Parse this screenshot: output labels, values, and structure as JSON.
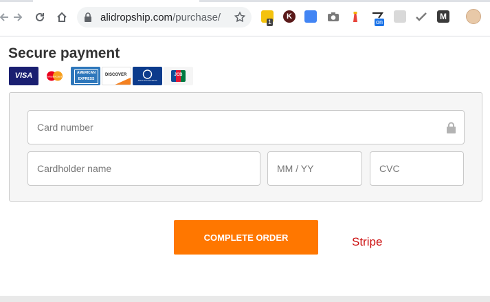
{
  "browser": {
    "url_domain": "alidropship.com",
    "url_path": "/purchase/",
    "extensions": [
      {
        "name": "notes-extension",
        "badge": "1",
        "color": "#f4c20d",
        "badge_color": "#444444"
      },
      {
        "name": "k-extension",
        "color": "#5a1a1a",
        "letter": "K"
      },
      {
        "name": "google-translate-extension",
        "color": "#4285f4"
      },
      {
        "name": "camera-extension",
        "color": "#7a7a7a"
      },
      {
        "name": "lighthouse-extension",
        "color": "#e8453c"
      },
      {
        "name": "toggle-extension",
        "badge": "on",
        "badge_color": "#1a73e8"
      },
      {
        "name": "translator-extension",
        "color": "#b5b5b5"
      },
      {
        "name": "check-extension",
        "color": "#7a7a7a"
      },
      {
        "name": "m-extension",
        "color": "#3a3a3a",
        "letter": "M"
      }
    ]
  },
  "page": {
    "title": "Secure payment",
    "card_brands": [
      {
        "name": "visa",
        "label": "VISA",
        "bg": "#1a1f71",
        "fg": "#ffffff"
      },
      {
        "name": "mastercard",
        "label": "MasterCard",
        "bg": "#ffffff",
        "fg": "#333333"
      },
      {
        "name": "amex",
        "label": "AMERICAN EXPRESS",
        "bg": "#2e77bb",
        "fg": "#ffffff"
      },
      {
        "name": "discover",
        "label": "DISCOVER",
        "bg": "#ffffff",
        "fg": "#222222"
      },
      {
        "name": "diners-club",
        "label": "Diners Club International",
        "bg": "#0c3b8c",
        "fg": "#ffffff"
      },
      {
        "name": "jcb",
        "label": "JCB",
        "bg": "#f5f5f5",
        "fg": "#333333"
      }
    ],
    "form": {
      "card_number": {
        "placeholder": "Card number",
        "value": ""
      },
      "cardholder_name": {
        "placeholder": "Cardholder name",
        "value": ""
      },
      "expiry": {
        "placeholder": "MM / YY",
        "value": ""
      },
      "cvc": {
        "placeholder": "CVC",
        "value": ""
      }
    },
    "complete_order_label": "COMPLETE ORDER",
    "stripe_label": "Stripe"
  }
}
